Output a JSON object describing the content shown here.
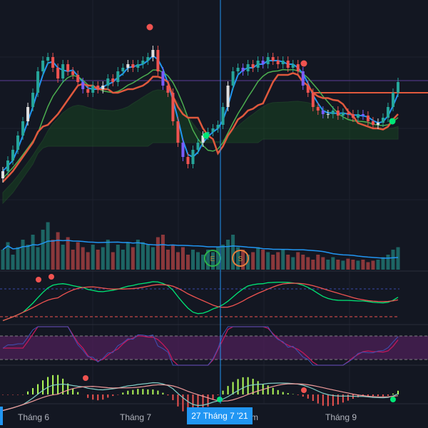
{
  "colors": {
    "up": "#26a69a",
    "down": "#ef5350",
    "ma_fast": "#2196f3",
    "ma_mid": "#4caf50",
    "ma_slow": "#e0593d",
    "cloud": "#1b5e20",
    "crosshair": "#2196f3",
    "band": "#4a1f55"
  },
  "axis": {
    "labels": [
      "Tháng 6",
      "Tháng 7",
      "m",
      "Tháng 9"
    ],
    "crosshair_label": "27 Tháng 7 '21"
  },
  "markers": {
    "earnings": "E",
    "split": "S"
  },
  "chart_data": {
    "type": "line",
    "title": "",
    "xlabel": "",
    "ylabel": "",
    "series": [
      {
        "name": "close",
        "values": [
          60,
          75,
          90,
          110,
          130,
          150,
          170,
          200,
          215,
          220,
          205,
          190,
          210,
          200,
          195,
          185,
          175,
          170,
          180,
          175,
          180,
          190,
          185,
          200,
          205,
          210,
          205,
          210,
          215,
          220,
          230,
          200,
          180,
          170,
          130,
          100,
          80,
          70,
          90,
          100,
          110,
          115,
          120,
          125,
          150,
          180,
          200,
          205,
          200,
          210,
          205,
          215,
          210,
          220,
          215,
          210,
          215,
          205,
          210,
          200,
          180,
          170,
          150,
          145,
          140,
          140,
          145,
          138,
          142,
          140,
          135,
          140,
          138,
          130,
          125,
          128,
          135,
          150,
          170,
          185
        ]
      },
      {
        "name": "volume",
        "values": [
          40,
          55,
          30,
          45,
          60,
          50,
          70,
          45,
          80,
          95,
          60,
          75,
          50,
          65,
          40,
          55,
          45,
          35,
          50,
          40,
          45,
          60,
          35,
          50,
          40,
          55,
          45,
          60,
          55,
          50,
          45,
          65,
          70,
          40,
          50,
          35,
          45,
          30,
          40,
          35,
          30,
          40,
          35,
          45,
          50,
          60,
          70,
          45,
          40,
          30,
          35,
          45,
          40,
          35,
          30,
          35,
          40,
          30,
          25,
          35,
          30,
          25,
          20,
          30,
          25,
          20,
          25,
          20,
          18,
          22,
          20,
          18,
          20,
          15,
          18,
          20,
          25,
          30,
          40,
          45
        ]
      }
    ],
    "grid": true,
    "legend": "none"
  }
}
